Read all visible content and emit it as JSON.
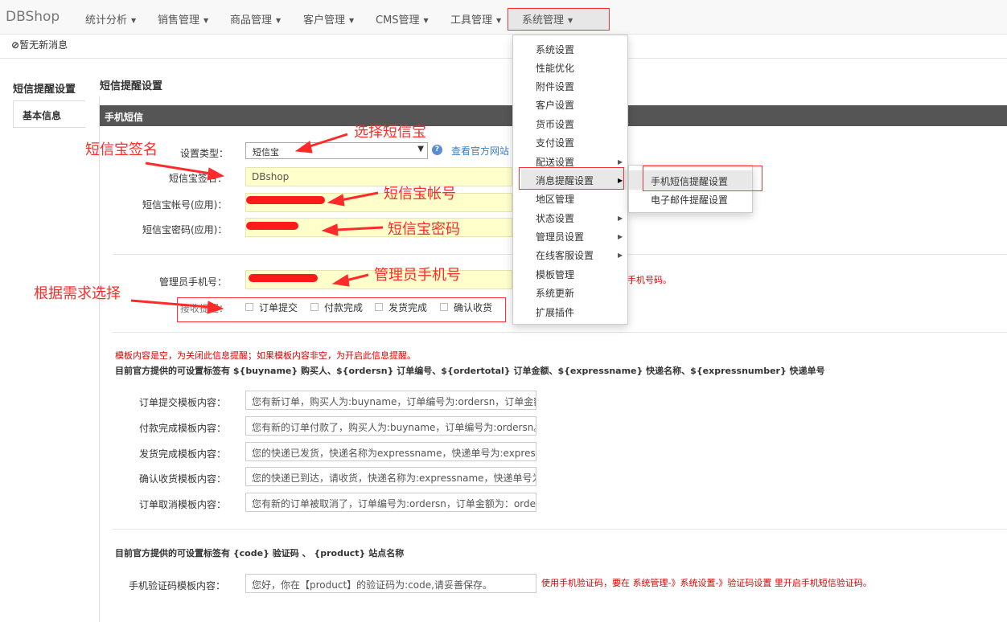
{
  "nav": {
    "brand": "DBShop",
    "items": [
      {
        "label": "统计分析"
      },
      {
        "label": "销售管理"
      },
      {
        "label": "商品管理"
      },
      {
        "label": "客户管理"
      },
      {
        "label": "CMS管理"
      },
      {
        "label": "工具管理"
      },
      {
        "label": "系统管理"
      }
    ]
  },
  "messages": {
    "text": "暂无新消息"
  },
  "sidebar": {
    "title": "短信提醒设置",
    "items": [
      {
        "label": "基本信息"
      }
    ]
  },
  "main": {
    "title": "短信提醒设置",
    "section": "手机短信",
    "type_label": "设置类型：",
    "type_value": "短信宝",
    "official_link": "查看官方网站",
    "sign_label": "短信宝签名：",
    "sign_value": "DBshop",
    "account_label": "短信宝帐号(应用)：",
    "password_label": "短信宝密码(应用)：",
    "admin_phone_label": "管理员手机号：",
    "admin_phone_help": "手机号码。",
    "receive_label": "接收提醒：",
    "options": [
      {
        "label": "订单提交"
      },
      {
        "label": "付款完成"
      },
      {
        "label": "发货完成"
      },
      {
        "label": "确认收货"
      }
    ],
    "template_note_red": "模板内容是空，为关闭此信息提醒；如果模板内容非空，为开启此信息提醒。",
    "template_note_tags": "目前官方提供的可设置标签有 ${buyname} 购买人、${ordersn} 订单编号、${ordertotal} 订单金额、${expressname} 快递名称、${expressnumber} 快递单号",
    "templates": [
      {
        "label": "订单提交模板内容：",
        "value": "您有新订单，购买人为:buyname，订单编号为:ordersn，订单金额为:ordertotal"
      },
      {
        "label": "付款完成模板内容：",
        "value": "您有新的订单付款了，购买人为:buyname，订单编号为:ordersn。"
      },
      {
        "label": "发货完成模板内容：",
        "value": "您的快递已发货，快递名称为expressname，快递单号为:expressnumber"
      },
      {
        "label": "确认收货模板内容：",
        "value": "您的快递已到达，请收货，快递名称为:expressname，快递单号为:expressnumber"
      },
      {
        "label": "订单取消模板内容：",
        "value": "您有新的订单被取消了，订单编号为:ordersn，订单金额为：ordertotal"
      }
    ],
    "code_note": "目前官方提供的可设置标签有 {code} 验证码 、 {product} 站点名称",
    "code_label": "手机验证码模板内容：",
    "code_value": "您好，你在【product】的验证码为:code,请妥善保存。",
    "code_help": "使用手机验证码，要在 系统管理-》系统设置-》验证码设置 里开启手机短信验证码。"
  },
  "system_menu": {
    "items": [
      {
        "label": "系统设置"
      },
      {
        "label": "性能优化"
      },
      {
        "label": "附件设置"
      },
      {
        "label": "客户设置"
      },
      {
        "label": "货币设置"
      },
      {
        "label": "支付设置"
      },
      {
        "label": "配送设置"
      },
      {
        "label": "消息提醒设置"
      },
      {
        "label": "地区管理"
      },
      {
        "label": "状态设置"
      },
      {
        "label": "管理员设置"
      },
      {
        "label": "在线客服设置"
      },
      {
        "label": "模板管理"
      },
      {
        "label": "系统更新"
      },
      {
        "label": "扩展插件"
      }
    ],
    "submenu": [
      {
        "label": "手机短信提醒设置"
      },
      {
        "label": "电子邮件提醒设置"
      }
    ]
  },
  "annotations": {
    "select_sms": "选择短信宝",
    "sign": "短信宝签名",
    "account": "短信宝帐号",
    "password": "短信宝密码",
    "admin_phone": "管理员手机号",
    "choose": "根据需求选择"
  },
  "colors": {
    "annotation": "#ff2a2a",
    "section_bar": "#555555",
    "field_highlight": "#ffffcc"
  }
}
